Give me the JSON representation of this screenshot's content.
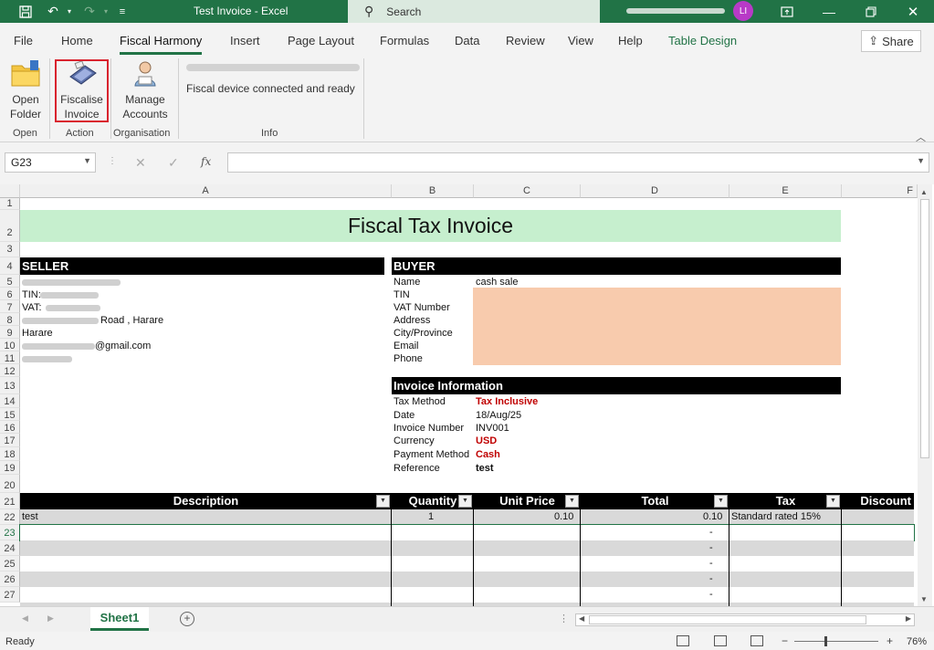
{
  "titlebar": {
    "title": "Test Invoice  -  Excel",
    "search_label": "Search",
    "avatar_initials": "LI"
  },
  "menu": {
    "tabs": [
      "File",
      "Home",
      "Fiscal Harmony",
      "Insert",
      "Page Layout",
      "Formulas",
      "Data",
      "Review",
      "View",
      "Help",
      "Table Design"
    ],
    "active": "Fiscal Harmony",
    "share_label": "Share"
  },
  "ribbon": {
    "open_folder_label": "Open\nFolder",
    "fiscalise_label": "Fiscalise\nInvoice",
    "manage_accounts_label": "Manage\nAccounts",
    "info_status": "Fiscal device connected and ready",
    "groups": [
      "Open",
      "Action",
      "Organisation",
      "Info"
    ]
  },
  "formula_bar": {
    "name_box": "G23",
    "fx_symbol": "fx",
    "content": ""
  },
  "grid": {
    "columns": [
      "A",
      "B",
      "C",
      "D",
      "E",
      "F"
    ],
    "rows": [
      "1",
      "2",
      "3",
      "4",
      "5",
      "6",
      "7",
      "8",
      "9",
      "10",
      "11",
      "12",
      "13",
      "14",
      "15",
      "16",
      "17",
      "18",
      "19",
      "20",
      "21",
      "22",
      "23",
      "24",
      "25",
      "26",
      "27"
    ],
    "title": "Fiscal Tax Invoice",
    "seller": {
      "header": "SELLER",
      "tin_label": "TIN:",
      "vat_label": "VAT:",
      "road_text": "Road , Harare",
      "city": "Harare",
      "email_suffix": "@gmail.com"
    },
    "buyer": {
      "header": "BUYER",
      "labels": [
        "Name",
        "TIN",
        "VAT Number",
        "Address",
        "City/Province",
        "Email",
        "Phone"
      ],
      "name_value": "cash sale"
    },
    "invoice_info": {
      "header": "Invoice Information",
      "labels": [
        "Tax Method",
        "Date",
        "Invoice Number",
        "Currency",
        "Payment Method",
        "Reference"
      ],
      "values": [
        "Tax Inclusive",
        "18/Aug/25",
        "INV001",
        "USD",
        "Cash",
        "test"
      ]
    },
    "table": {
      "headers": [
        "Description",
        "Quantity",
        "Unit Price",
        "Total",
        "Tax",
        "Discount"
      ],
      "row1": {
        "description": "test",
        "quantity": "1",
        "unit_price": "0.10",
        "total": "0.10",
        "tax": "Standard rated 15%"
      },
      "empty_total": "-"
    }
  },
  "sheets": {
    "tabs": [
      "Sheet1"
    ],
    "add_symbol": "+"
  },
  "status": {
    "ready": "Ready",
    "zoom": "76%"
  }
}
